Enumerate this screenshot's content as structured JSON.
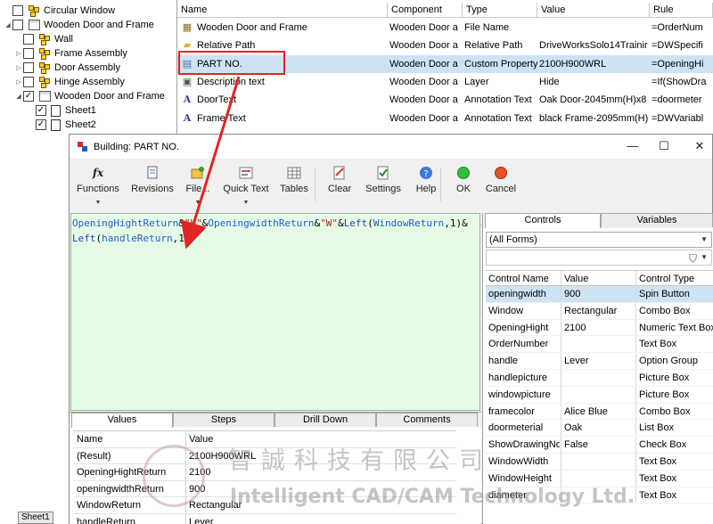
{
  "tree": {
    "items": [
      {
        "label": "Circular Window",
        "checked": false,
        "expander": "",
        "icon": "assembly-icon"
      },
      {
        "label": "Wooden Door and Frame",
        "checked": false,
        "expander": "◢",
        "icon": "table-icon"
      },
      {
        "label": "Wall",
        "checked": false,
        "expander": "",
        "icon": "assembly-icon"
      },
      {
        "label": "Frame Assembly",
        "checked": false,
        "expander": "▷",
        "icon": "assembly-icon"
      },
      {
        "label": "Door Assembly",
        "checked": false,
        "expander": "▷",
        "icon": "assembly-icon"
      },
      {
        "label": "Hinge Assembly",
        "checked": false,
        "expander": "▷",
        "icon": "assembly-icon"
      },
      {
        "label": "Wooden Door and Frame",
        "checked": true,
        "expander": "◢",
        "icon": "table-icon"
      },
      {
        "label": "Sheet1",
        "checked": true,
        "expander": "",
        "icon": "sheet-icon"
      },
      {
        "label": "Sheet2",
        "checked": true,
        "expander": "",
        "icon": "sheet-icon"
      }
    ]
  },
  "properties": {
    "headers": {
      "name": "Name",
      "component": "Component",
      "type": "Type",
      "value": "Value",
      "rule": "Rule"
    },
    "rows": [
      {
        "name": "Wooden Door and Frame",
        "component": "Wooden Door a",
        "type": "File Name",
        "value": "",
        "rule": "=OrderNum",
        "icon": "file-icon"
      },
      {
        "name": "Relative Path",
        "component": "Wooden Door a",
        "type": "Relative Path",
        "value": "DriveWorksSolo14Trainir",
        "rule": "=DWSpecifi",
        "icon": "folder-icon"
      },
      {
        "name": "PART NO.",
        "component": "Wooden Door a",
        "type": "Custom Property",
        "value": "2100H900WRL",
        "rule": "=OpeningHi",
        "icon": "custom-property-icon"
      },
      {
        "name": "Description text",
        "component": "Wooden Door a",
        "type": "Layer",
        "value": "Hide",
        "rule": "=If(ShowDra",
        "icon": "layer-icon"
      },
      {
        "name": "DoorText",
        "component": "Wooden Door a",
        "type": "Annotation Text",
        "value": "Oak Door-2045mm(H)x8",
        "rule": "=doormeter",
        "icon": "annotation-icon"
      },
      {
        "name": "Frame Text",
        "component": "Wooden Door a",
        "type": "Annotation Text",
        "value": "black Frame-2095mm(H)",
        "rule": "=DWVariabl",
        "icon": "annotation-icon"
      }
    ]
  },
  "dialog": {
    "title": "Building: PART NO.",
    "controls_glyphs": {
      "minimize": "—",
      "maximize": "☐",
      "close": "✕"
    },
    "toolbar": [
      {
        "label": "Functions",
        "icon": "fx-icon",
        "glyph": "fx",
        "dropdown": true
      },
      {
        "label": "Revisions",
        "icon": "revisions-icon",
        "glyph": "",
        "dropdown": false
      },
      {
        "label": "File...",
        "icon": "file-icon",
        "glyph": "",
        "dropdown": true
      },
      {
        "label": "Quick Text",
        "icon": "quick-text-icon",
        "glyph": "",
        "dropdown": true
      },
      {
        "label": "Tables",
        "icon": "tables-icon",
        "glyph": "",
        "dropdown": false
      },
      {
        "label": "Clear",
        "icon": "clear-icon",
        "glyph": "",
        "dropdown": false
      },
      {
        "label": "Settings",
        "icon": "settings-icon",
        "glyph": "",
        "dropdown": false
      },
      {
        "label": "Help",
        "icon": "help-icon",
        "glyph": "",
        "dropdown": false
      },
      {
        "label": "OK",
        "icon": "ok-icon",
        "glyph": "",
        "dropdown": false
      },
      {
        "label": "Cancel",
        "icon": "cancel-icon",
        "glyph": "",
        "dropdown": false
      }
    ],
    "rule_tokens_line1": [
      {
        "t": "OpeningHightReturn",
        "k": "ctl"
      },
      {
        "t": "&",
        "k": "op"
      },
      {
        "t": "\"H\"",
        "k": "str"
      },
      {
        "t": "&",
        "k": "op"
      },
      {
        "t": "OpeningwidthReturn",
        "k": "ctl"
      },
      {
        "t": "&",
        "k": "op"
      },
      {
        "t": "\"W\"",
        "k": "str"
      },
      {
        "t": "&",
        "k": "op"
      },
      {
        "t": "Left",
        "k": "fn"
      },
      {
        "t": "(",
        "k": "op"
      },
      {
        "t": "WindowReturn",
        "k": "ctl"
      },
      {
        "t": ",1)&",
        "k": "op"
      }
    ],
    "rule_tokens_line2": [
      {
        "t": "Left",
        "k": "fn"
      },
      {
        "t": "(",
        "k": "op"
      },
      {
        "t": "handleReturn",
        "k": "ctl"
      },
      {
        "t": ",1)",
        "k": "op"
      }
    ],
    "bottom_tabs": [
      "Values",
      "Steps",
      "Drill Down",
      "Comments"
    ],
    "values": {
      "headers": {
        "name": "Name",
        "value": "Value"
      },
      "rows": [
        {
          "name": "(Result)",
          "value": "2100H900WRL"
        },
        {
          "name": "OpeningHightReturn",
          "value": "2100"
        },
        {
          "name": "openingwidthReturn",
          "value": "900"
        },
        {
          "name": "WindowReturn",
          "value": "Rectangular"
        },
        {
          "name": "handleReturn",
          "value": "Lever"
        }
      ]
    },
    "right_tabs": [
      "Controls",
      "Variables"
    ],
    "forms_combo": "(All Forms)",
    "controls": {
      "headers": {
        "name": "Control Name",
        "value": "Value",
        "type": "Control Type"
      },
      "rows": [
        {
          "name": "openingwidth",
          "value": "900",
          "type": "Spin Button"
        },
        {
          "name": "Window",
          "value": "Rectangular",
          "type": "Combo Box"
        },
        {
          "name": "OpeningHight",
          "value": "2100",
          "type": "Numeric Text Box"
        },
        {
          "name": "OrderNumber",
          "value": "",
          "type": "Text Box"
        },
        {
          "name": "handle",
          "value": "Lever",
          "type": "Option Group"
        },
        {
          "name": "handlepicture",
          "value": "",
          "type": "Picture Box"
        },
        {
          "name": "windowpicture",
          "value": "",
          "type": "Picture Box"
        },
        {
          "name": "framecolor",
          "value": "Alice Blue",
          "type": "Combo Box"
        },
        {
          "name": "doormeterial",
          "value": "Oak",
          "type": "List Box"
        },
        {
          "name": "ShowDrawingNo",
          "value": "False",
          "type": "Check Box"
        },
        {
          "name": "WindowWidth",
          "value": "",
          "type": "Text Box"
        },
        {
          "name": "WindowHeight",
          "value": "",
          "type": "Text Box"
        },
        {
          "name": "diameter",
          "value": "",
          "type": "Text Box"
        }
      ]
    }
  },
  "watermark": {
    "chinese": "智誠科技有限公司",
    "english": "Intelligent CAD/CAM Technology Ltd."
  },
  "sheet_tab": "Sheet1",
  "colors": {
    "accent_red": "#e02525",
    "editor_bg": "#e6fbe6",
    "selection": "#cde3f4"
  }
}
